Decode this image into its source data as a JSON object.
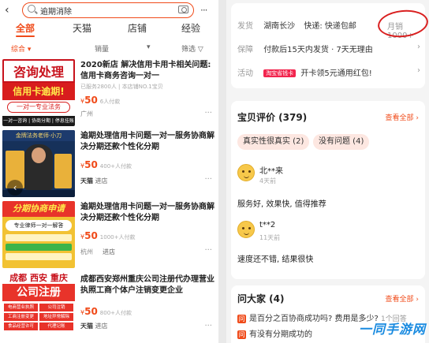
{
  "left": {
    "search": {
      "back_icon": "‹",
      "query": "逾期消除",
      "more_icon": "···"
    },
    "tabs": [
      "全部",
      "天猫",
      "店铺",
      "经验"
    ],
    "filters": [
      "综合 ▾",
      "销量",
      "▾",
      "筛选 ▽"
    ],
    "items": [
      {
        "title": "2020新店 解决信用卡用卡相关问题:信用卡商务咨询一对一",
        "sub": "已服务2800人 | 本店铺NO.1宝贝",
        "price_symbol": "¥",
        "price": "50",
        "paid": "6人付款",
        "location": "广州",
        "shop": "",
        "shop_suffix": "",
        "thumb": {
          "line1": "咨询处理",
          "line2": "信用卡逾期!",
          "line3": "一对一专业法务",
          "line4": "一对一咨询 | 协商分期 | 停息挂账"
        }
      },
      {
        "title": "逾期处理信用卡问题一对一服务协商解决分期还款个性化分期",
        "sub": "",
        "price_symbol": "¥",
        "price": "50",
        "paid": "400+人付款",
        "location": "",
        "shop": "",
        "shop_suffix": "进店",
        "thumb": {
          "line1": "金牌法务老师·小刀"
        }
      },
      {
        "title": "逾期处理信用卡问题一对一服务协商解决分期还款个性化分期",
        "sub": "",
        "price_symbol": "¥",
        "price": "50",
        "paid": "1000+人付款",
        "location": "杭州",
        "shop": "",
        "shop_suffix": "进店",
        "thumb": {
          "line1": "分期协商申请",
          "line2": "专业律师一对一解答"
        }
      },
      {
        "title": "成都西安郑州重庆公司注册代办理营业执照工商个体户注销变更企业",
        "sub": "",
        "price_symbol": "¥",
        "price": "50",
        "paid": "800+人付款",
        "location": "",
        "shop": "",
        "shop_suffix": "进店",
        "thumb": {
          "line1": "成都 西安 重庆",
          "line2": "公司注册",
          "cells": [
            "电商营业执照",
            "公司注销",
            "工商注册变更",
            "地址异常解除",
            "食品经营许可",
            "代理记账"
          ]
        }
      }
    ]
  },
  "right": {
    "shipping": {
      "label": "发货",
      "from": "湖南长沙",
      "method": "快递: 快递包邮",
      "sales": "月销1000+"
    },
    "guarantee": {
      "label": "保障",
      "text": "付款后15天内发货 · 7天无理由"
    },
    "promo": {
      "label": "活动",
      "badge": "淘宝省钱卡",
      "text": "开卡领5元通用红包!"
    },
    "reviews": {
      "title": "宝贝评价 (379)",
      "see_all": "查看全部 ›",
      "tags": [
        "真实性很真实 (2)",
        "没有问题 (4)"
      ],
      "list": [
        {
          "user": "北**来",
          "ago": "4天前",
          "text": "服务好, 效果快, 值得推荐"
        },
        {
          "user": "t**2",
          "ago": "11天前",
          "text": "速度还不错, 结果很快"
        }
      ]
    },
    "qa": {
      "title": "问大家 (4)",
      "see_all": "查看全部 ›",
      "list": [
        {
          "icon": "问",
          "q": "是百分之百协商成功吗? 费用是多少?",
          "count": "1个回答"
        },
        {
          "icon": "问",
          "q": "有没有分期成功的",
          "count": ""
        }
      ]
    }
  },
  "watermark": "一同手游网",
  "colors": {
    "accent": "#f04b1a",
    "circle": "#d91f1f"
  }
}
